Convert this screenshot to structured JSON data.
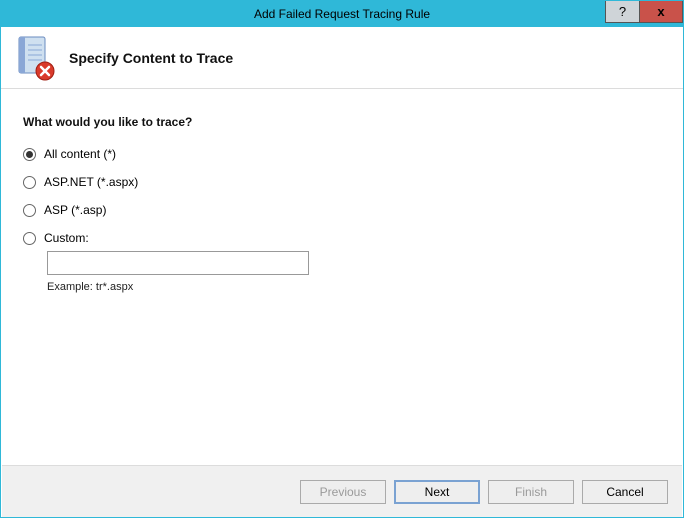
{
  "window": {
    "title": "Add Failed Request Tracing Rule"
  },
  "header": {
    "title": "Specify Content to Trace"
  },
  "prompt": "What would you like to trace?",
  "options": {
    "all": "All content (*)",
    "aspnet": "ASP.NET (*.aspx)",
    "asp": "ASP (*.asp)",
    "custom": "Custom:"
  },
  "custom_value": "",
  "example": "Example: tr*.aspx",
  "buttons": {
    "previous": "Previous",
    "next": "Next",
    "finish": "Finish",
    "cancel": "Cancel"
  },
  "titlebar": {
    "help": "?",
    "close": "x"
  }
}
